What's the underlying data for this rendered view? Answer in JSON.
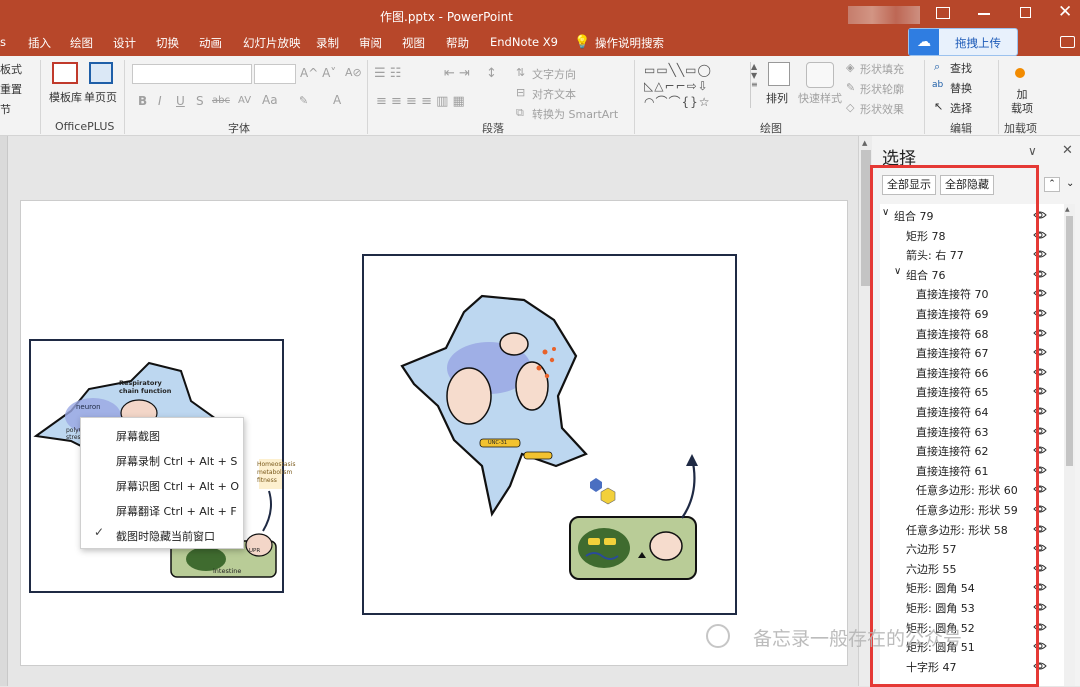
{
  "window": {
    "title": "作图.pptx  -  PowerPoint"
  },
  "menu": {
    "items": [
      "s",
      "插入",
      "绘图",
      "设计",
      "切换",
      "动画",
      "幻灯片放映",
      "录制",
      "审阅",
      "视图",
      "帮助",
      "EndNote X9",
      "操作说明搜索"
    ],
    "upload": "拖拽上传"
  },
  "ribbon": {
    "left_items": [
      "板式",
      "重置",
      "节"
    ],
    "officeplus": {
      "template": "模板库",
      "single": "单页页",
      "label": "OfficePLUS"
    },
    "font": {
      "label": "字体",
      "format_buttons": [
        "B",
        "I",
        "U",
        "S",
        "abc",
        "AV",
        "Aa",
        "A"
      ]
    },
    "paragraph": {
      "label": "段落",
      "text_direction": "文字方向",
      "align_text": "对齐文本",
      "smartart": "转换为 SmartArt"
    },
    "drawing": {
      "label": "绘图",
      "arrange": "排列",
      "quick_styles": "快速样式",
      "fill": "形状填充",
      "outline": "形状轮廓",
      "effects": "形状效果"
    },
    "editing": {
      "label": "编辑",
      "find": "查找",
      "replace": "替换",
      "select": "选择"
    },
    "addins": {
      "label": "加载项",
      "load": "加\n载项"
    }
  },
  "context_menu": {
    "items": [
      "屏幕截图",
      "屏幕录制 Ctrl + Alt + S",
      "屏幕识图 Ctrl + Alt + O",
      "屏幕翻译 Ctrl + Alt + F",
      "截图时隐藏当前窗口"
    ]
  },
  "slide": {
    "small_panel": {
      "rc_label": "Respiratory\nchain function",
      "neuron": "neuron",
      "poly": "polyQ\nstress",
      "homeo": "Homeostasis\nmetabolism\nfitness",
      "intestine": "intestine",
      "upr": "UPR"
    },
    "large_panel": {
      "unc": "UNC-31"
    }
  },
  "selection_pane": {
    "title": "选择",
    "show_all": "全部显示",
    "hide_all": "全部隐藏",
    "items": [
      {
        "name": "组合 79",
        "level": 0,
        "expand": true
      },
      {
        "name": "矩形 78",
        "level": 1
      },
      {
        "name": "箭头: 右 77",
        "level": 1
      },
      {
        "name": "组合 76",
        "level": 1,
        "expand": true
      },
      {
        "name": "直接连接符 70",
        "level": 2
      },
      {
        "name": "直接连接符 69",
        "level": 2
      },
      {
        "name": "直接连接符 68",
        "level": 2
      },
      {
        "name": "直接连接符 67",
        "level": 2
      },
      {
        "name": "直接连接符 66",
        "level": 2
      },
      {
        "name": "直接连接符 65",
        "level": 2
      },
      {
        "name": "直接连接符 64",
        "level": 2
      },
      {
        "name": "直接连接符 63",
        "level": 2
      },
      {
        "name": "直接连接符 62",
        "level": 2
      },
      {
        "name": "直接连接符 61",
        "level": 2
      },
      {
        "name": "任意多边形: 形状 60",
        "level": 2
      },
      {
        "name": "任意多边形: 形状 59",
        "level": 2
      },
      {
        "name": "任意多边形: 形状 58",
        "level": 1
      },
      {
        "name": "六边形 57",
        "level": 1
      },
      {
        "name": "六边形 55",
        "level": 1
      },
      {
        "name": "矩形: 圆角 54",
        "level": 1
      },
      {
        "name": "矩形: 圆角 53",
        "level": 1
      },
      {
        "name": "矩形: 圆角 52",
        "level": 1
      },
      {
        "name": "矩形: 圆角 51",
        "level": 1
      },
      {
        "name": "十字形 47",
        "level": 1
      }
    ]
  },
  "watermark": "备忘录一般存在的公众号",
  "colors": {
    "accent": "#b7472a",
    "highlight": "#e53935",
    "cell_fill": "#bdd7f0",
    "green_box": "#b9cc97"
  }
}
